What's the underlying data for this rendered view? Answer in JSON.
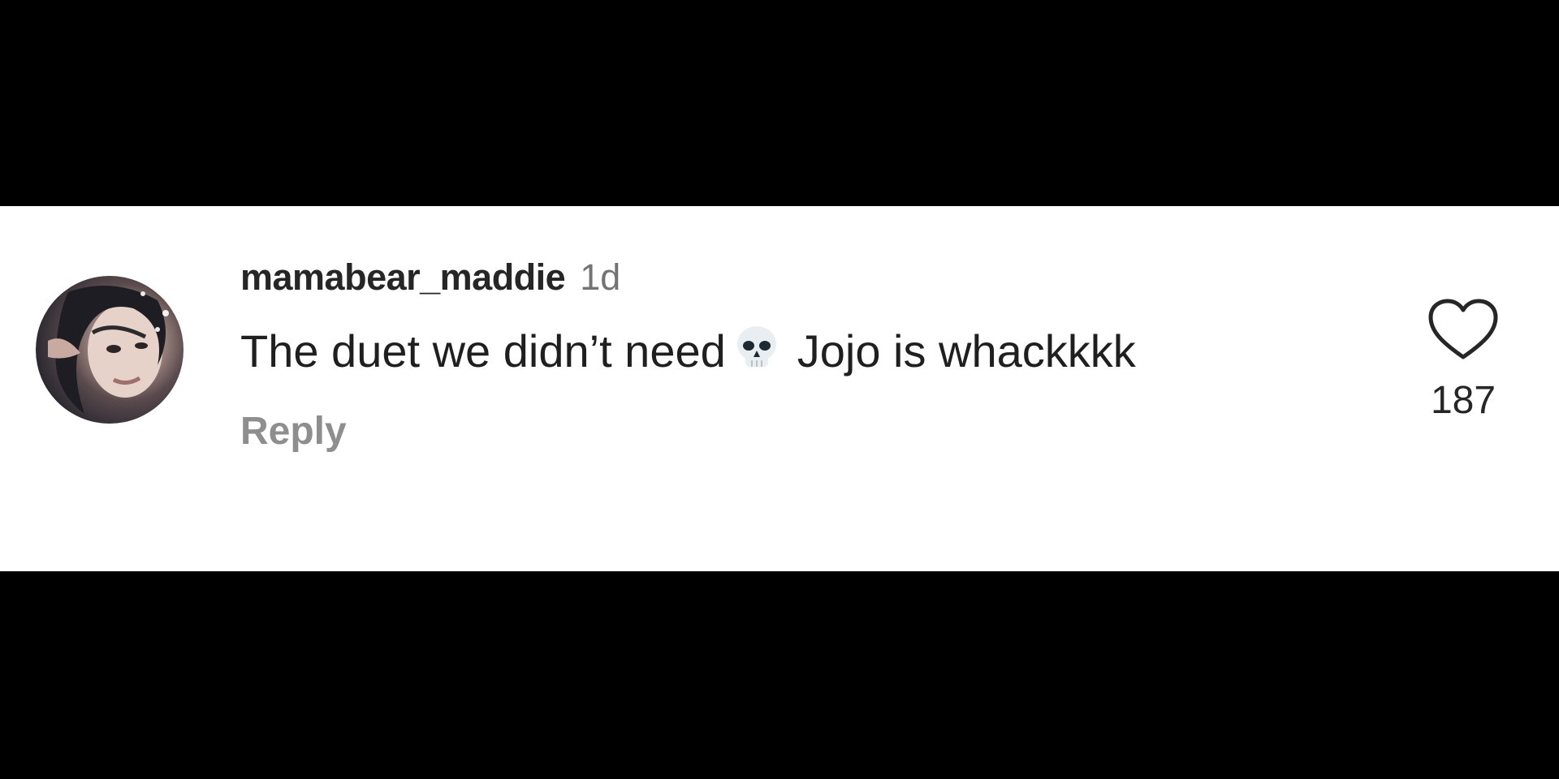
{
  "comment": {
    "username": "mamabear_maddie",
    "timestamp": "1d",
    "text_before_emoji": "The duet we didn’t need",
    "emoji": "skull-emoji",
    "text_after_emoji": "Jojo is whackkkk",
    "reply_label": "Reply",
    "like_icon": "heart-outline-icon",
    "like_count": "187"
  },
  "colors": {
    "background_bars": "#000000",
    "card_background": "#ffffff",
    "username": "#262626",
    "timestamp": "#737373",
    "reply": "#8e8e8e"
  }
}
